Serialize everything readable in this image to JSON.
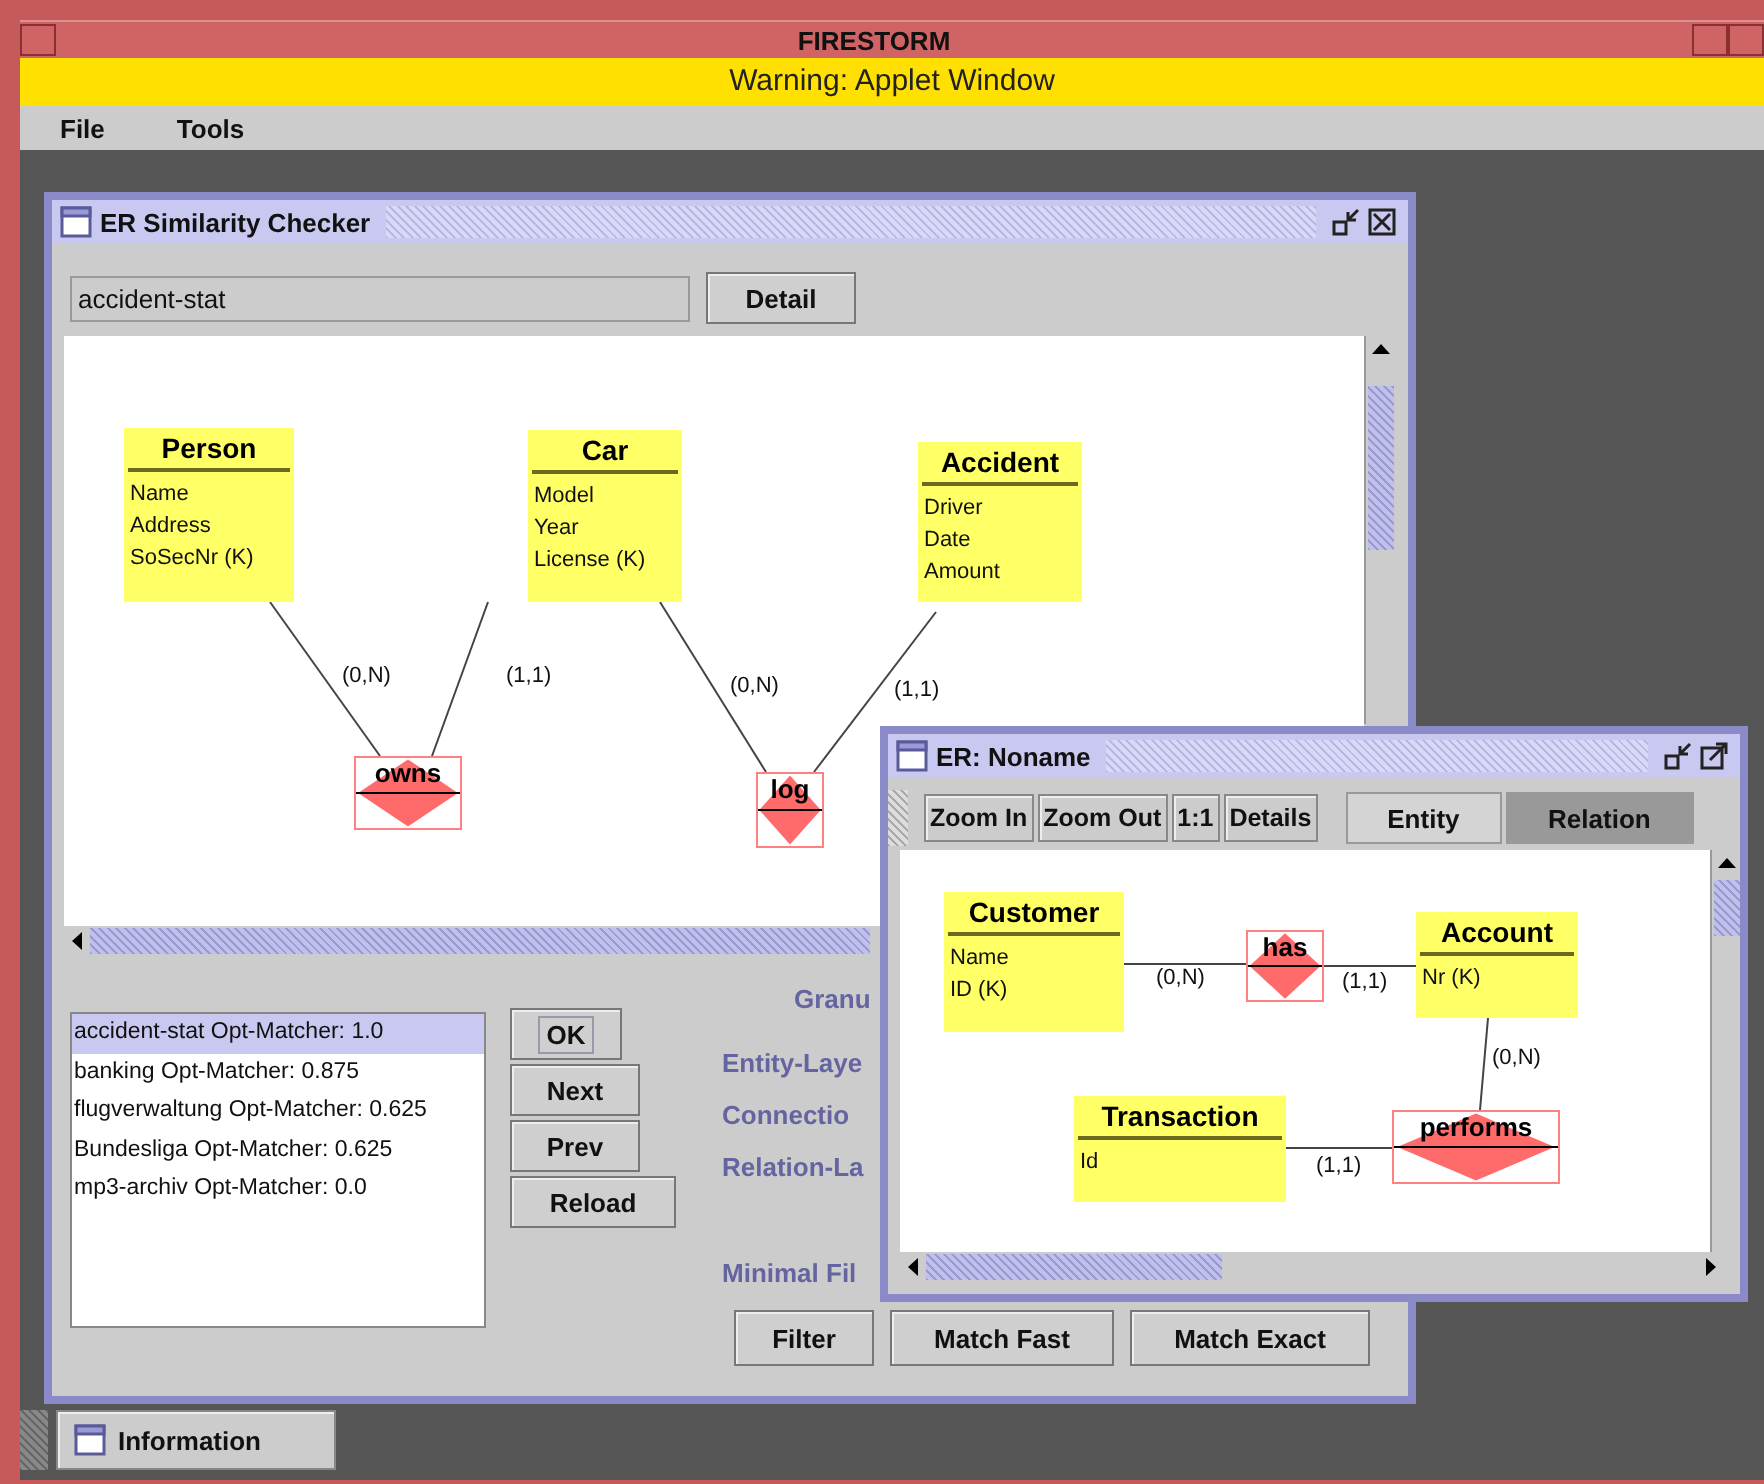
{
  "app_window": {
    "title": "FIRESTORM",
    "warning": "Warning: Applet Window"
  },
  "menu": [
    "File",
    "Tools"
  ],
  "similarity_window": {
    "title": "ER Similarity Checker",
    "schema_field": {
      "value": "accident-stat"
    },
    "detail_button": "Detail",
    "diagram": {
      "entities": [
        {
          "name": "Person",
          "attributes": [
            "Name",
            "Address",
            "SoSecNr (K)"
          ]
        },
        {
          "name": "Car",
          "attributes": [
            "Model",
            "Year",
            "License (K)"
          ]
        },
        {
          "name": "Accident",
          "attributes": [
            "Driver",
            "Date",
            "Amount"
          ]
        }
      ],
      "relationships": [
        {
          "name": "owns"
        },
        {
          "name": "log"
        }
      ],
      "connections": [
        {
          "cardinality": "(0,N)"
        },
        {
          "cardinality": "(1,1)"
        },
        {
          "cardinality": "(0,N)"
        },
        {
          "cardinality": "(1,1)"
        }
      ]
    },
    "results": [
      {
        "label": "accident-stat Opt-Matcher: 1.0",
        "selected": true
      },
      {
        "label": "banking Opt-Matcher: 0.875",
        "selected": false
      },
      {
        "label": "flugverwaltung Opt-Matcher: 0.625",
        "selected": false
      },
      {
        "label": "Bundesliga Opt-Matcher: 0.625",
        "selected": false
      },
      {
        "label": "mp3-archiv Opt-Matcher: 0.0",
        "selected": false
      }
    ],
    "nav_buttons": [
      "OK",
      "Next",
      "Prev",
      "Reload"
    ],
    "option_labels": [
      "Granu",
      "Entity-Laye",
      "Connectio",
      "Relation-La",
      "Minimal Fil"
    ],
    "action_buttons": [
      "Filter",
      "Match Fast",
      "Match Exact"
    ]
  },
  "editor_window": {
    "title": "ER: Noname",
    "toolbar": [
      "Zoom In",
      "Zoom Out",
      "1:1",
      "Details"
    ],
    "mode_tabs": [
      {
        "label": "Entity",
        "selected": false
      },
      {
        "label": "Relation",
        "selected": true
      }
    ],
    "diagram": {
      "entities": [
        {
          "name": "Customer",
          "attributes": [
            "Name",
            "ID (K)"
          ]
        },
        {
          "name": "Account",
          "attributes": [
            "Nr (K)"
          ]
        },
        {
          "name": "Transaction",
          "attributes": [
            "Id"
          ]
        }
      ],
      "relationships": [
        {
          "name": "has"
        },
        {
          "name": "performs"
        }
      ],
      "connections": [
        {
          "cardinality": "(0,N)"
        },
        {
          "cardinality": "(1,1)"
        },
        {
          "cardinality": "(0,N)"
        },
        {
          "cardinality": "(1,1)"
        }
      ]
    }
  },
  "taskbar": [
    {
      "label": "Information"
    }
  ]
}
